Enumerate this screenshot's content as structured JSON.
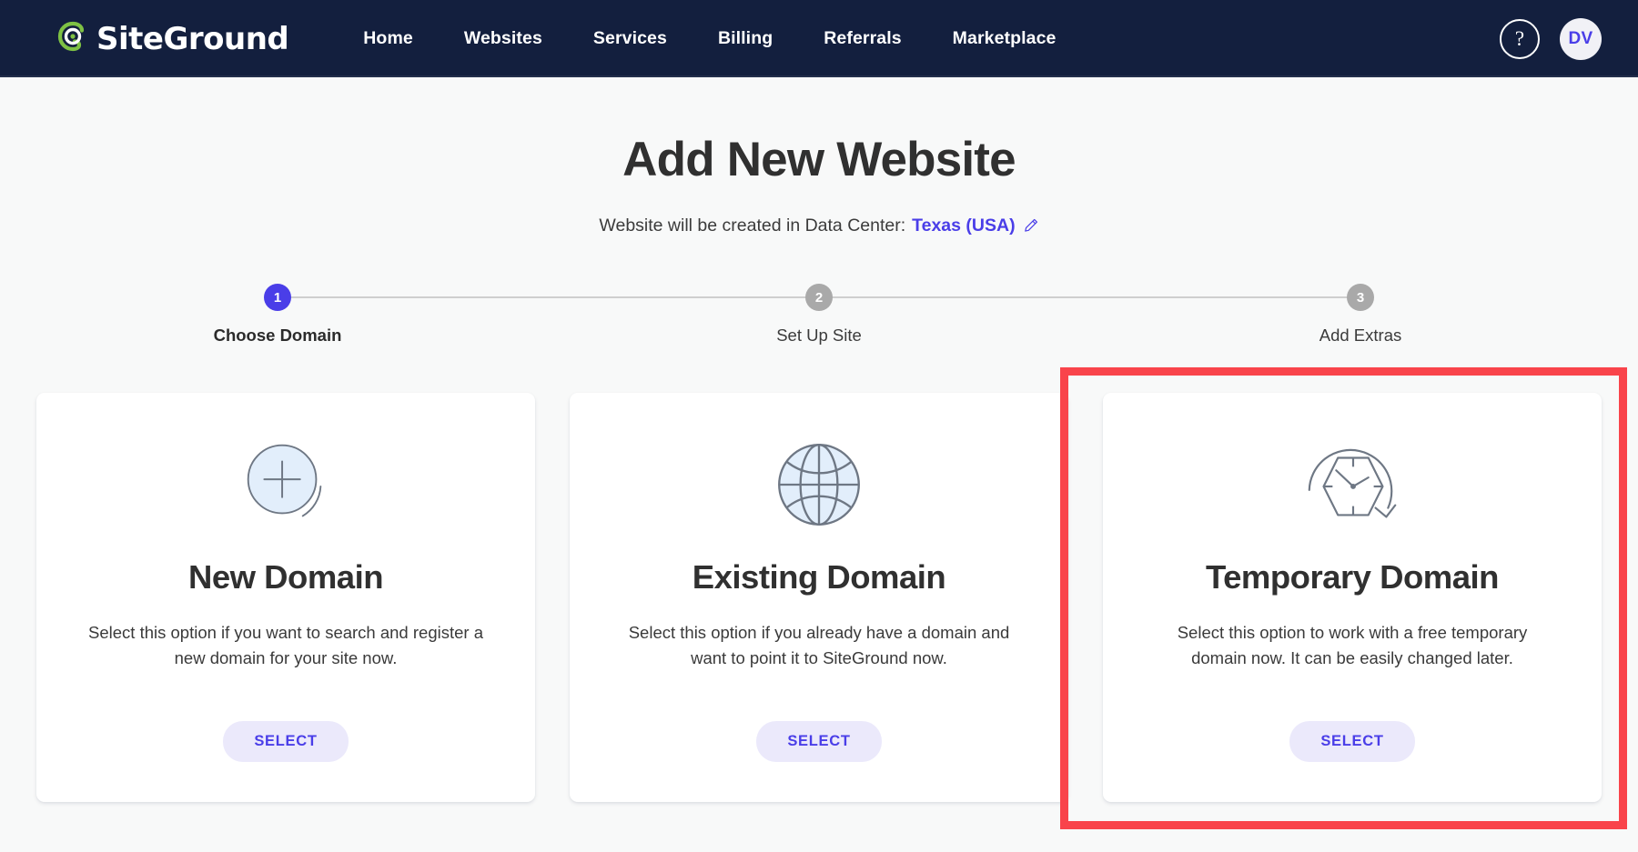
{
  "header": {
    "brand": {
      "logo_icon": "siteground-spiral-icon",
      "name": "SiteGround",
      "icon_color": "#7ec144"
    },
    "nav_items": [
      {
        "label": "Home"
      },
      {
        "label": "Websites"
      },
      {
        "label": "Services"
      },
      {
        "label": "Billing"
      },
      {
        "label": "Referrals"
      },
      {
        "label": "Marketplace"
      }
    ],
    "help": {
      "icon": "question-mark-icon",
      "label": "?"
    },
    "avatar": {
      "initials": "DV"
    },
    "background_color": "#131f3e"
  },
  "page": {
    "title": "Add New Website",
    "subtitle_prefix": "Website will be created in Data Center:",
    "data_center": "Texas (USA)",
    "edit_icon": "pencil-icon",
    "accent_color": "#4a3ee8",
    "background_color": "#f8f9f9"
  },
  "stepper": {
    "steps": [
      {
        "number": "1",
        "label": "Choose Domain",
        "state": "active"
      },
      {
        "number": "2",
        "label": "Set Up Site",
        "state": "idle"
      },
      {
        "number": "3",
        "label": "Add Extras",
        "state": "idle"
      }
    ],
    "active_color": "#4a3ee8",
    "idle_color": "#a9a9a9"
  },
  "cards": [
    {
      "icon": "plus-circle-icon",
      "title": "New Domain",
      "description": "Select this option if you want to search and register a new domain for your site now.",
      "button_label": "SELECT",
      "highlighted": false
    },
    {
      "icon": "globe-icon",
      "title": "Existing Domain",
      "description": "Select this option if you already have a domain and want to point it to SiteGround now.",
      "button_label": "SELECT",
      "highlighted": false
    },
    {
      "icon": "temporary-clock-icon",
      "title": "Temporary Domain",
      "description": "Select this option to work with a free temporary domain now. It can be easily changed later.",
      "button_label": "SELECT",
      "highlighted": true
    }
  ],
  "highlight": {
    "color": "#f9444b",
    "target": "Temporary Domain"
  }
}
